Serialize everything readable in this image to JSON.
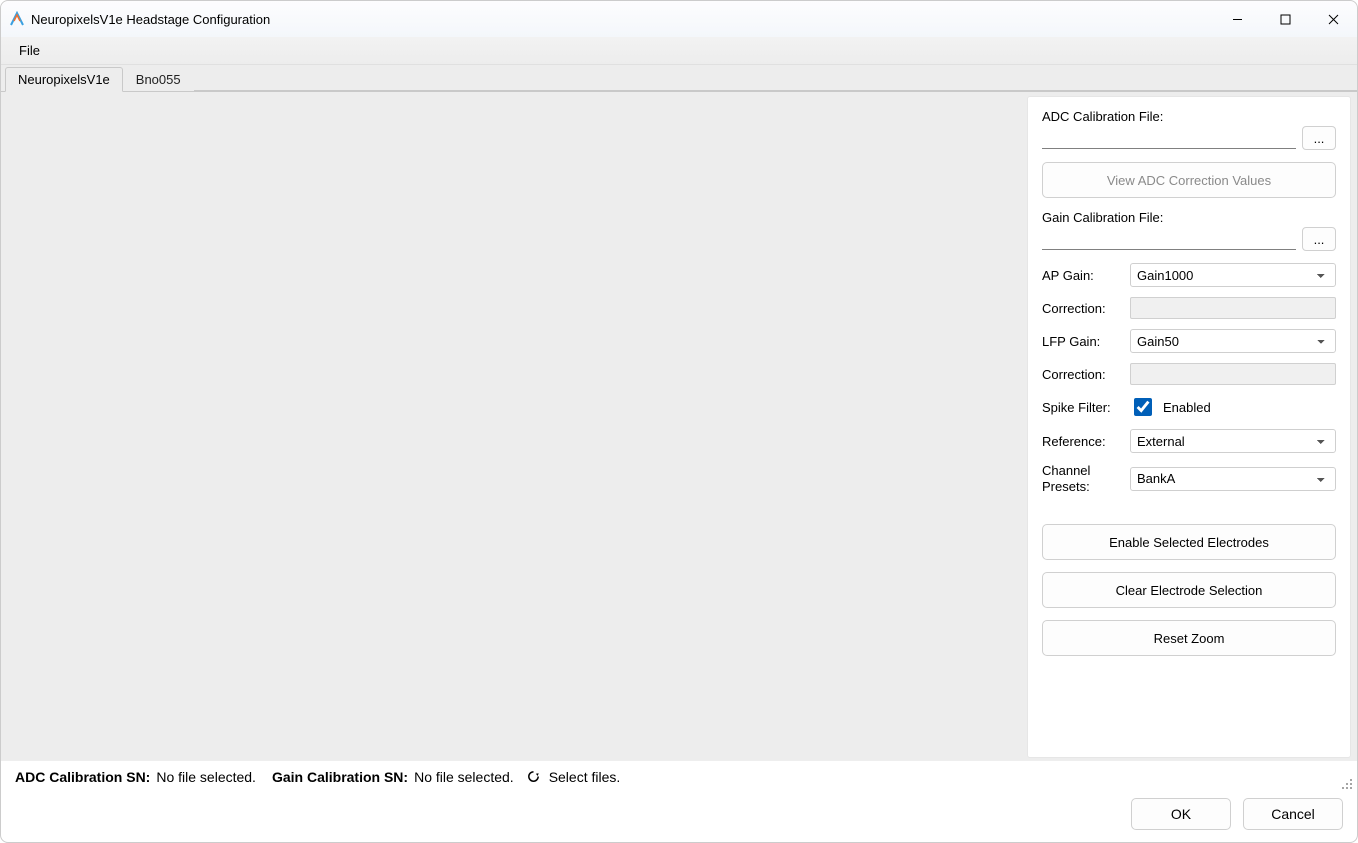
{
  "titlebar": {
    "title": "NeuropixelsV1e Headstage Configuration"
  },
  "menubar": {
    "file": "File"
  },
  "tabs": {
    "t0": "NeuropixelsV1e",
    "t1": "Bno055"
  },
  "panel": {
    "adc_file_label": "ADC Calibration File:",
    "adc_file_value": "",
    "browse_label": "...",
    "view_adc_btn": "View ADC Correction Values",
    "gain_file_label": "Gain Calibration File:",
    "gain_file_value": "",
    "ap_gain_label": "AP Gain:",
    "ap_gain_value": "Gain1000",
    "ap_correction_label": "Correction:",
    "lfp_gain_label": "LFP Gain:",
    "lfp_gain_value": "Gain50",
    "lfp_correction_label": "Correction:",
    "spike_filter_label": "Spike Filter:",
    "spike_filter_check_label": "Enabled",
    "spike_filter_checked": true,
    "reference_label": "Reference:",
    "reference_value": "External",
    "presets_label": "Channel Presets:",
    "presets_value": "BankA",
    "enable_btn": "Enable Selected Electrodes",
    "clear_btn": "Clear Electrode Selection",
    "reset_btn": "Reset Zoom"
  },
  "status": {
    "adc_sn_label": "ADC Calibration SN:",
    "adc_sn_value": "No file selected.",
    "gain_sn_label": "Gain Calibration SN:",
    "gain_sn_value": "No file selected.",
    "select_files": "Select files."
  },
  "buttons": {
    "ok": "OK",
    "cancel": "Cancel"
  }
}
